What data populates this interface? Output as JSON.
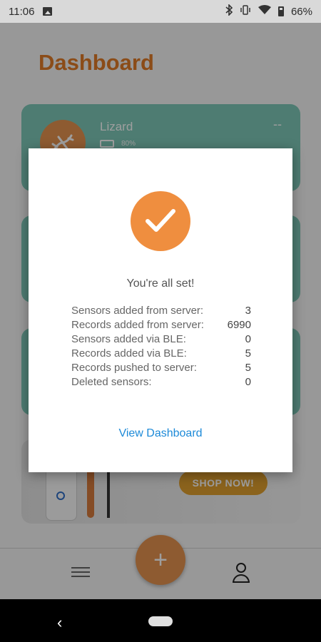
{
  "status_bar": {
    "time": "11:06",
    "battery_percent": "66%",
    "icons": [
      "image-icon",
      "bluetooth-icon",
      "vibrate-icon",
      "wifi-icon",
      "battery-icon"
    ]
  },
  "dashboard": {
    "title": "Dashboard",
    "cards": [
      {
        "name": "Lizard",
        "battery": "80%",
        "reading": "--"
      }
    ],
    "shop_button": "SHOP NOW!"
  },
  "dialog": {
    "title": "You're all set!",
    "stats": [
      {
        "label": "Sensors added from server:",
        "value": "3"
      },
      {
        "label": "Records added from server:",
        "value": "6990"
      },
      {
        "label": "Sensors added via BLE:",
        "value": "0"
      },
      {
        "label": "Records added via BLE:",
        "value": "5"
      },
      {
        "label": "Records pushed to server:",
        "value": "5"
      },
      {
        "label": "Deleted sensors:",
        "value": "0"
      }
    ],
    "link_text": "View Dashboard"
  },
  "bottom_nav": {
    "fab_label": "+"
  },
  "colors": {
    "accent": "#e69450",
    "card": "#7fc9b8",
    "link": "#1d8ad8",
    "title": "#e07b27"
  }
}
